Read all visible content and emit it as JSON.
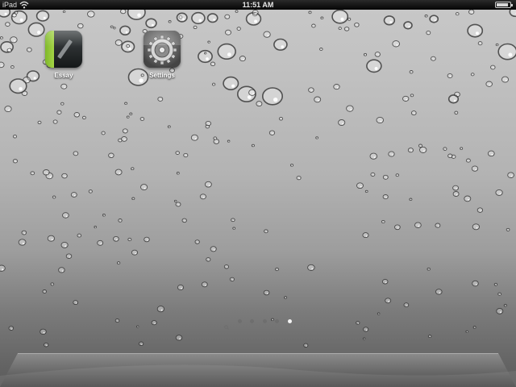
{
  "status_bar": {
    "carrier": "iPad",
    "wifi_icon": "wifi-icon",
    "time": "11:51 AM",
    "battery_icon": "battery-icon",
    "battery_level": 0.9
  },
  "apps": [
    {
      "label": "Essay",
      "icon": "notebook-pencil-icon"
    },
    {
      "label": "Settings",
      "icon": "gear-icon"
    }
  ],
  "page_control": {
    "pages": 5,
    "current_page": 5,
    "first_indicator_icon": "search-icon"
  },
  "dock": {
    "items": []
  },
  "colors": {
    "accent_green": "#8cc63f",
    "status_bar_bg": "#0a0a0a"
  }
}
